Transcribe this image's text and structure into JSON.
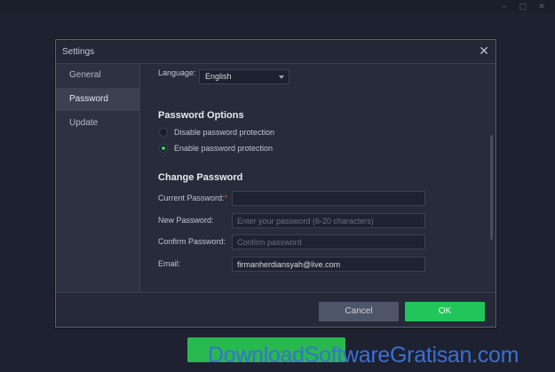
{
  "window": {
    "controls": [
      "–",
      "✕"
    ]
  },
  "dialog": {
    "title": "Settings",
    "close_icon": "close-icon"
  },
  "sidebar": {
    "items": [
      {
        "label": "General"
      },
      {
        "label": "Password",
        "active": true
      },
      {
        "label": "Update"
      }
    ]
  },
  "content": {
    "language_label": "Language:",
    "language_value": "English",
    "password_options_title": "Password Options",
    "options": [
      {
        "label": "Disable password protection",
        "checked": false
      },
      {
        "label": "Enable password protection",
        "checked": true
      }
    ],
    "change_password_title": "Change Password",
    "fields": {
      "current_label": "Current Password:",
      "current_required_mark": "*",
      "current_value": "",
      "new_label": "New Password:",
      "new_placeholder": "Enter your password (6-20 characters)",
      "confirm_label": "Confirm Password:",
      "confirm_placeholder": "Confirm password",
      "email_label": "Email:",
      "email_value": "firmanherdiansyah@live.com"
    }
  },
  "footer": {
    "cancel_label": "Cancel",
    "ok_label": "OK"
  },
  "watermark": "DownloadSoftwareGratisan.com",
  "colors": {
    "accent_green": "#22c55a",
    "background": "#1e2230",
    "dialog": "#272b3a"
  }
}
